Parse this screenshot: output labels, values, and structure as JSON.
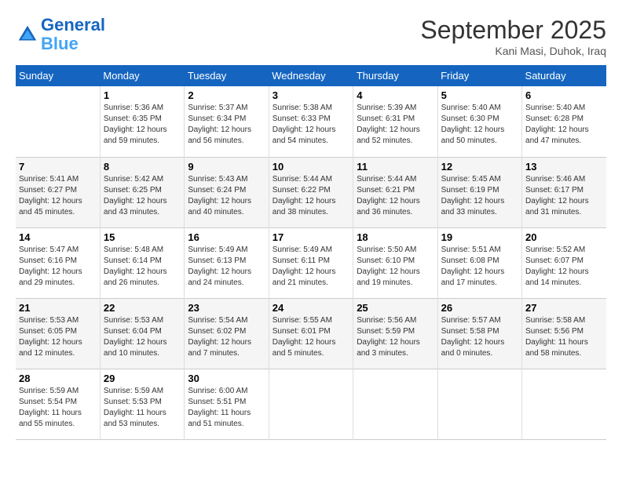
{
  "header": {
    "logo_line1": "General",
    "logo_line2": "Blue",
    "month": "September 2025",
    "location": "Kani Masi, Duhok, Iraq"
  },
  "weekdays": [
    "Sunday",
    "Monday",
    "Tuesday",
    "Wednesday",
    "Thursday",
    "Friday",
    "Saturday"
  ],
  "weeks": [
    [
      {
        "day": "",
        "info": ""
      },
      {
        "day": "1",
        "info": "Sunrise: 5:36 AM\nSunset: 6:35 PM\nDaylight: 12 hours\nand 59 minutes."
      },
      {
        "day": "2",
        "info": "Sunrise: 5:37 AM\nSunset: 6:34 PM\nDaylight: 12 hours\nand 56 minutes."
      },
      {
        "day": "3",
        "info": "Sunrise: 5:38 AM\nSunset: 6:33 PM\nDaylight: 12 hours\nand 54 minutes."
      },
      {
        "day": "4",
        "info": "Sunrise: 5:39 AM\nSunset: 6:31 PM\nDaylight: 12 hours\nand 52 minutes."
      },
      {
        "day": "5",
        "info": "Sunrise: 5:40 AM\nSunset: 6:30 PM\nDaylight: 12 hours\nand 50 minutes."
      },
      {
        "day": "6",
        "info": "Sunrise: 5:40 AM\nSunset: 6:28 PM\nDaylight: 12 hours\nand 47 minutes."
      }
    ],
    [
      {
        "day": "7",
        "info": "Sunrise: 5:41 AM\nSunset: 6:27 PM\nDaylight: 12 hours\nand 45 minutes."
      },
      {
        "day": "8",
        "info": "Sunrise: 5:42 AM\nSunset: 6:25 PM\nDaylight: 12 hours\nand 43 minutes."
      },
      {
        "day": "9",
        "info": "Sunrise: 5:43 AM\nSunset: 6:24 PM\nDaylight: 12 hours\nand 40 minutes."
      },
      {
        "day": "10",
        "info": "Sunrise: 5:44 AM\nSunset: 6:22 PM\nDaylight: 12 hours\nand 38 minutes."
      },
      {
        "day": "11",
        "info": "Sunrise: 5:44 AM\nSunset: 6:21 PM\nDaylight: 12 hours\nand 36 minutes."
      },
      {
        "day": "12",
        "info": "Sunrise: 5:45 AM\nSunset: 6:19 PM\nDaylight: 12 hours\nand 33 minutes."
      },
      {
        "day": "13",
        "info": "Sunrise: 5:46 AM\nSunset: 6:17 PM\nDaylight: 12 hours\nand 31 minutes."
      }
    ],
    [
      {
        "day": "14",
        "info": "Sunrise: 5:47 AM\nSunset: 6:16 PM\nDaylight: 12 hours\nand 29 minutes."
      },
      {
        "day": "15",
        "info": "Sunrise: 5:48 AM\nSunset: 6:14 PM\nDaylight: 12 hours\nand 26 minutes."
      },
      {
        "day": "16",
        "info": "Sunrise: 5:49 AM\nSunset: 6:13 PM\nDaylight: 12 hours\nand 24 minutes."
      },
      {
        "day": "17",
        "info": "Sunrise: 5:49 AM\nSunset: 6:11 PM\nDaylight: 12 hours\nand 21 minutes."
      },
      {
        "day": "18",
        "info": "Sunrise: 5:50 AM\nSunset: 6:10 PM\nDaylight: 12 hours\nand 19 minutes."
      },
      {
        "day": "19",
        "info": "Sunrise: 5:51 AM\nSunset: 6:08 PM\nDaylight: 12 hours\nand 17 minutes."
      },
      {
        "day": "20",
        "info": "Sunrise: 5:52 AM\nSunset: 6:07 PM\nDaylight: 12 hours\nand 14 minutes."
      }
    ],
    [
      {
        "day": "21",
        "info": "Sunrise: 5:53 AM\nSunset: 6:05 PM\nDaylight: 12 hours\nand 12 minutes."
      },
      {
        "day": "22",
        "info": "Sunrise: 5:53 AM\nSunset: 6:04 PM\nDaylight: 12 hours\nand 10 minutes."
      },
      {
        "day": "23",
        "info": "Sunrise: 5:54 AM\nSunset: 6:02 PM\nDaylight: 12 hours\nand 7 minutes."
      },
      {
        "day": "24",
        "info": "Sunrise: 5:55 AM\nSunset: 6:01 PM\nDaylight: 12 hours\nand 5 minutes."
      },
      {
        "day": "25",
        "info": "Sunrise: 5:56 AM\nSunset: 5:59 PM\nDaylight: 12 hours\nand 3 minutes."
      },
      {
        "day": "26",
        "info": "Sunrise: 5:57 AM\nSunset: 5:58 PM\nDaylight: 12 hours\nand 0 minutes."
      },
      {
        "day": "27",
        "info": "Sunrise: 5:58 AM\nSunset: 5:56 PM\nDaylight: 11 hours\nand 58 minutes."
      }
    ],
    [
      {
        "day": "28",
        "info": "Sunrise: 5:59 AM\nSunset: 5:54 PM\nDaylight: 11 hours\nand 55 minutes."
      },
      {
        "day": "29",
        "info": "Sunrise: 5:59 AM\nSunset: 5:53 PM\nDaylight: 11 hours\nand 53 minutes."
      },
      {
        "day": "30",
        "info": "Sunrise: 6:00 AM\nSunset: 5:51 PM\nDaylight: 11 hours\nand 51 minutes."
      },
      {
        "day": "",
        "info": ""
      },
      {
        "day": "",
        "info": ""
      },
      {
        "day": "",
        "info": ""
      },
      {
        "day": "",
        "info": ""
      }
    ]
  ]
}
